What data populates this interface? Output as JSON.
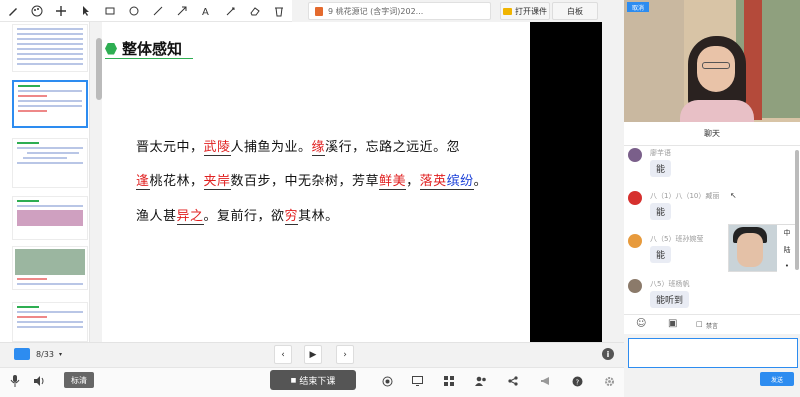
{
  "toolbar": {
    "tools": [
      "pen-icon",
      "palette-icon",
      "move-icon",
      "pointer-icon",
      "rectangle-icon",
      "circle-icon",
      "line-icon",
      "arrow-line-icon",
      "text-icon",
      "laser-icon",
      "eraser-icon",
      "clear-icon"
    ]
  },
  "doc_tab": {
    "title": "9 桃花源记 (含字词)202..."
  },
  "buttons": {
    "open_courseware": "打开课件",
    "whiteboard": "白板",
    "end_class": "结束下课",
    "biaoqing": "标清",
    "send": "发送"
  },
  "slide": {
    "title": "整体感知",
    "lines": [
      [
        {
          "t": "晋太元中，",
          "c": "n"
        },
        {
          "t": "武陵",
          "c": "r"
        },
        {
          "t": "人捕鱼为业。",
          "c": "n"
        },
        {
          "t": "缘",
          "c": "r"
        },
        {
          "t": "溪行，忘路之远近。忽",
          "c": "n"
        }
      ],
      [
        {
          "t": "逢",
          "c": "r"
        },
        {
          "t": "桃花林，",
          "c": "n"
        },
        {
          "t": "夹岸",
          "c": "r"
        },
        {
          "t": "数百步，中无杂树，芳草",
          "c": "n"
        },
        {
          "t": "鲜美",
          "c": "r"
        },
        {
          "t": "，",
          "c": "n"
        },
        {
          "t": "落英",
          "c": "r"
        },
        {
          "t": "缤纷",
          "c": "b"
        },
        {
          "t": "。",
          "c": "n"
        }
      ],
      [
        {
          "t": "渔人甚",
          "c": "n"
        },
        {
          "t": "异之",
          "c": "r"
        },
        {
          "t": "。复前行，欲",
          "c": "n"
        },
        {
          "t": "穷",
          "c": "r"
        },
        {
          "t": "其林。",
          "c": "n"
        }
      ]
    ]
  },
  "nav": {
    "page": "8/33",
    "prev": "‹",
    "play": "▶",
    "next": "›",
    "info": "i"
  },
  "video": {
    "badge": "取消"
  },
  "chat": {
    "header": "聊天",
    "messages": [
      {
        "name": "廖芊语",
        "text": "能",
        "avatar_color": "#7a5f8a"
      },
      {
        "name": "八（1）八（10）臧丽",
        "text": "能",
        "avatar_color": "#d6302e"
      },
      {
        "name": "八（5）班孙婉莹",
        "text": "能",
        "avatar_color": "#e79a3c"
      },
      {
        "name": "八5）班杨帆",
        "text": "能听到",
        "avatar_color": "#8b7a6a"
      }
    ],
    "popup_side": [
      "中",
      "陆",
      "•"
    ],
    "input_tools": {
      "emoji": "☺",
      "image": "▣",
      "flag": "□",
      "flag_label": "禁言"
    }
  },
  "bottom_icons": [
    "mic-icon",
    "speaker-icon",
    "record-icon",
    "screen-share-icon",
    "layout-icon",
    "users-icon",
    "share-icon",
    "megaphone-icon",
    "help-icon",
    "settings-icon"
  ]
}
